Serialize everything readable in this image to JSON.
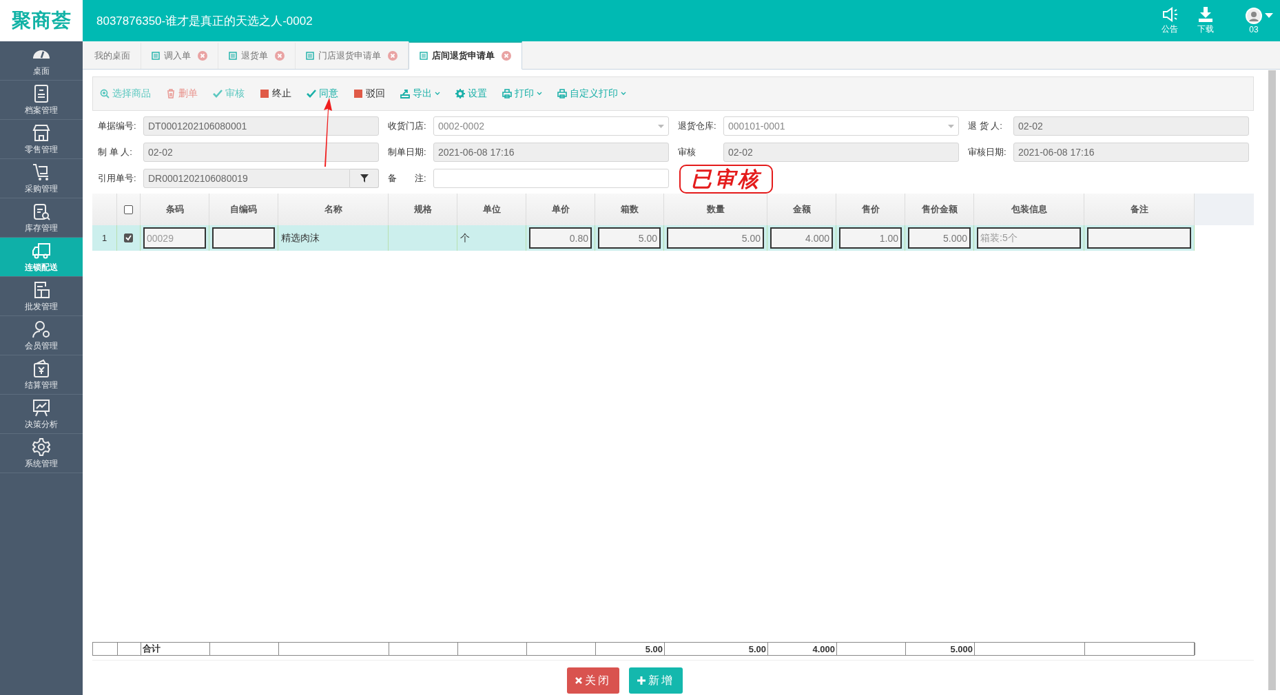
{
  "header": {
    "logo": "聚商荟",
    "title": "8037876350-谁才是真正的天选之人-0002",
    "actions": [
      {
        "label": "公告"
      },
      {
        "label": "下载"
      }
    ],
    "user": {
      "label": "03"
    }
  },
  "sidebar": {
    "items": [
      {
        "label": "桌面",
        "selected": false
      },
      {
        "label": "档案管理",
        "selected": false
      },
      {
        "label": "零售管理",
        "selected": false
      },
      {
        "label": "采购管理",
        "selected": false
      },
      {
        "label": "库存管理",
        "selected": false
      },
      {
        "label": "连锁配送",
        "selected": true
      },
      {
        "label": "批发管理",
        "selected": false
      },
      {
        "label": "会员管理",
        "selected": false
      },
      {
        "label": "结算管理",
        "selected": false
      },
      {
        "label": "决策分析",
        "selected": false
      },
      {
        "label": "系统管理",
        "selected": false
      }
    ]
  },
  "tabs": [
    {
      "label": "我的桌面",
      "kind": "home",
      "selected": false,
      "closable": false
    },
    {
      "label": "调入单",
      "kind": "document",
      "selected": false,
      "closable": true
    },
    {
      "label": "退货单",
      "kind": "document",
      "selected": false,
      "closable": true
    },
    {
      "label": "门店退货申请单",
      "kind": "document",
      "selected": false,
      "closable": true
    },
    {
      "label": "店间退货申请单",
      "kind": "document",
      "selected": true,
      "closable": true
    }
  ],
  "toolbar": [
    {
      "label": "选择商品",
      "disabled": true,
      "dropdown": false
    },
    {
      "label": "删单",
      "disabled": true,
      "dropdown": false
    },
    {
      "label": "审核",
      "disabled": true,
      "dropdown": false
    },
    {
      "label": "终止",
      "disabled": false,
      "dropdown": false
    },
    {
      "label": "同意",
      "disabled": false,
      "dropdown": false
    },
    {
      "label": "驳回",
      "disabled": false,
      "dropdown": false
    },
    {
      "label": "导出",
      "disabled": false,
      "dropdown": true
    },
    {
      "label": "设置",
      "disabled": false,
      "dropdown": false
    },
    {
      "label": "打印",
      "disabled": false,
      "dropdown": true
    },
    {
      "label": "自定义打印",
      "disabled": false,
      "dropdown": true
    }
  ],
  "form": {
    "rows": [
      [
        {
          "label": "单据编号:",
          "value": "DT0001202106080001",
          "kind": "readonly"
        },
        {
          "label": "收货门店:",
          "value": "0002-0002",
          "kind": "select"
        },
        {
          "label": "退货仓库:",
          "value": "000101-0001",
          "kind": "select"
        },
        {
          "label": "退 货 人:",
          "value": "02-02",
          "kind": "readonly"
        }
      ],
      [
        {
          "label": "制 单 人:",
          "value": "02-02",
          "kind": "readonly"
        },
        {
          "label": "制单日期:",
          "value": "2021-06-08 17:16",
          "kind": "readonly"
        },
        {
          "label": "审核",
          "value": "02-02",
          "kind": "readonly"
        },
        {
          "label": "审核日期:",
          "value": "2021-06-08 17:16",
          "kind": "readonly"
        }
      ],
      [
        {
          "label": "引用单号:",
          "value": "DR0001202106080019",
          "kind": "lookup"
        },
        {
          "label": "备　　注:",
          "kind": "input"
        }
      ]
    ]
  },
  "stamp": {
    "text": "已审核"
  },
  "table": {
    "all_checked": false,
    "columns": [
      {
        "title": "条码",
        "total": "合计"
      },
      {
        "title": "自编码"
      },
      {
        "title": "名称"
      },
      {
        "title": "规格"
      },
      {
        "title": "单位"
      },
      {
        "title": "单价"
      },
      {
        "title": "箱数",
        "total": "5.00"
      },
      {
        "title": "数量",
        "total": "5.00"
      },
      {
        "title": "金额",
        "total": "4.000"
      },
      {
        "title": "售价"
      },
      {
        "title": "售价金额",
        "total": "5.000"
      },
      {
        "title": "包装信息"
      },
      {
        "title": "备注"
      }
    ],
    "rows": [
      {
        "index": "1",
        "checked": true,
        "selected": true,
        "cells": [
          {
            "kind": "input",
            "text": "00029"
          },
          {
            "kind": "input"
          },
          {
            "kind": "text",
            "text": "精选肉沫"
          },
          {
            "kind": "text"
          },
          {
            "kind": "text",
            "text": "个"
          },
          {
            "kind": "number",
            "text": "0.80"
          },
          {
            "kind": "number",
            "text": "5.00"
          },
          {
            "kind": "number",
            "text": "5.00"
          },
          {
            "kind": "number",
            "text": "4.000"
          },
          {
            "kind": "number",
            "text": "1.00"
          },
          {
            "kind": "number",
            "text": "5.000"
          },
          {
            "kind": "input",
            "text": "箱装:5个"
          },
          {
            "kind": "input"
          }
        ]
      }
    ]
  },
  "buttons": [
    {
      "label": "关闭",
      "kind": "close"
    },
    {
      "label": "新增",
      "kind": "add"
    }
  ]
}
